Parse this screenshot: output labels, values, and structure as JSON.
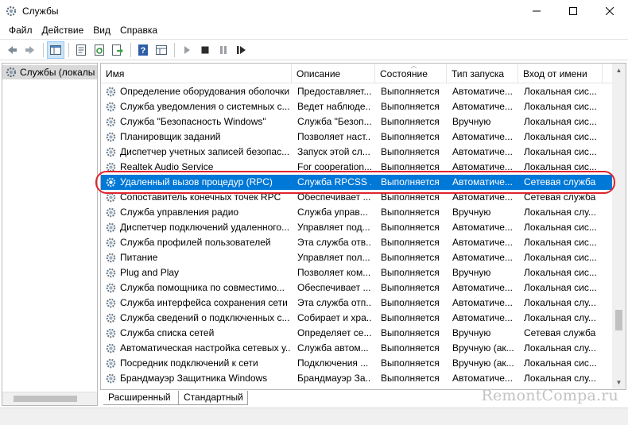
{
  "window": {
    "title": "Службы",
    "icon": "services-gear-icon"
  },
  "menu": [
    "Файл",
    "Действие",
    "Вид",
    "Справка"
  ],
  "toolbar": {
    "buttons": [
      "back-icon",
      "forward-icon",
      "show-tree-icon",
      "properties-icon",
      "refresh-icon",
      "export-icon",
      "help-icon",
      "view-icon",
      "start-service-icon",
      "stop-service-icon",
      "pause-service-icon",
      "restart-service-icon"
    ]
  },
  "tree": {
    "root_label": "Службы (локалы"
  },
  "columns": {
    "name": "Имя",
    "description": "Описание",
    "status": "Состояние",
    "startup": "Тип запуска",
    "logon": "Вход от имени"
  },
  "services": [
    {
      "name": "Определение оборудования оболочки",
      "description": "Предоставляет...",
      "status": "Выполняется",
      "startup": "Автоматиче...",
      "logon": "Локальная сис..."
    },
    {
      "name": "Служба уведомления о системных с...",
      "description": "Ведет наблюде...",
      "status": "Выполняется",
      "startup": "Автоматиче...",
      "logon": "Локальная сис..."
    },
    {
      "name": "Служба \"Безопасность Windows\"",
      "description": "Служба \"Безоп...",
      "status": "Выполняется",
      "startup": "Вручную",
      "logon": "Локальная сис..."
    },
    {
      "name": "Планировщик заданий",
      "description": "Позволяет наст...",
      "status": "Выполняется",
      "startup": "Автоматиче...",
      "logon": "Локальная сис..."
    },
    {
      "name": "Диспетчер учетных записей безопас...",
      "description": "Запуск этой сл...",
      "status": "Выполняется",
      "startup": "Автоматиче...",
      "logon": "Локальная сис..."
    },
    {
      "name": "Realtek Audio Service",
      "description": "For cooperation...",
      "status": "Выполняется",
      "startup": "Автоматиче...",
      "logon": "Локальная сис..."
    },
    {
      "name": "Удаленный вызов процедур (RPC)",
      "description": "Служба RPCSS ...",
      "status": "Выполняется",
      "startup": "Автоматиче...",
      "logon": "Сетевая служба",
      "selected": true
    },
    {
      "name": "Сопоставитель конечных точек RPC",
      "description": "Обеспечивает ...",
      "status": "Выполняется",
      "startup": "Автоматиче...",
      "logon": "Сетевая служба"
    },
    {
      "name": "Служба управления радио",
      "description": "Служба управ...",
      "status": "Выполняется",
      "startup": "Вручную",
      "logon": "Локальная слу..."
    },
    {
      "name": "Диспетчер подключений удаленного...",
      "description": "Управляет под...",
      "status": "Выполняется",
      "startup": "Автоматиче...",
      "logon": "Локальная сис..."
    },
    {
      "name": "Служба профилей пользователей",
      "description": "Эта служба отв...",
      "status": "Выполняется",
      "startup": "Автоматиче...",
      "logon": "Локальная сис..."
    },
    {
      "name": "Питание",
      "description": "Управляет пол...",
      "status": "Выполняется",
      "startup": "Автоматиче...",
      "logon": "Локальная сис..."
    },
    {
      "name": "Plug and Play",
      "description": "Позволяет ком...",
      "status": "Выполняется",
      "startup": "Вручную",
      "logon": "Локальная сис..."
    },
    {
      "name": "Служба помощника по совместимо...",
      "description": "Обеспечивает ...",
      "status": "Выполняется",
      "startup": "Автоматиче...",
      "logon": "Локальная сис..."
    },
    {
      "name": "Служба интерфейса сохранения сети",
      "description": "Эта служба отп...",
      "status": "Выполняется",
      "startup": "Автоматиче...",
      "logon": "Локальная слу..."
    },
    {
      "name": "Служба сведений о подключенных с...",
      "description": "Собирает и хра...",
      "status": "Выполняется",
      "startup": "Автоматиче...",
      "logon": "Локальная слу..."
    },
    {
      "name": "Служба списка сетей",
      "description": "Определяет се...",
      "status": "Выполняется",
      "startup": "Вручную",
      "logon": "Сетевая служба"
    },
    {
      "name": "Автоматическая настройка сетевых у...",
      "description": "Служба автом...",
      "status": "Выполняется",
      "startup": "Вручную (ак...",
      "logon": "Локальная слу..."
    },
    {
      "name": "Посредник подключений к сети",
      "description": "Подключения ...",
      "status": "Выполняется",
      "startup": "Вручную (ак...",
      "logon": "Локальная сис..."
    },
    {
      "name": "Брандмауэр Защитника Windows",
      "description": "Брандмауэр За...",
      "status": "Выполняется",
      "startup": "Автоматиче...",
      "logon": "Локальная слу..."
    }
  ],
  "tabs": {
    "extended": "Расширенный",
    "standard": "Стандартный"
  },
  "watermark": "RemontCompa.ru",
  "colors": {
    "selection": "#0078d7",
    "highlight_ring": "#e0242c"
  }
}
